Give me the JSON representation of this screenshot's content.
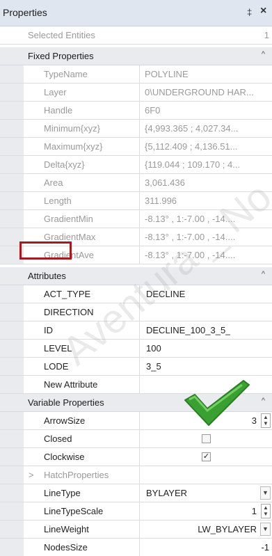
{
  "window": {
    "title": "Properties",
    "pin_glyph": "‡",
    "close_glyph": "×"
  },
  "selected": {
    "label": "Selected Entities",
    "value": "1"
  },
  "fixed": {
    "label": "Fixed Properties",
    "rows": [
      {
        "label": "TypeName",
        "value": "POLYLINE"
      },
      {
        "label": "Layer",
        "value": "0\\UNDERGROUND HAR..."
      },
      {
        "label": "Handle",
        "value": "6F0"
      },
      {
        "label": "Minimum{xyz}",
        "value": "{4,993.365 ; 4,027.34..."
      },
      {
        "label": "Maximum{xyz}",
        "value": "{5,112.409 ; 4,136.51..."
      },
      {
        "label": "Delta{xyz}",
        "value": "{119.044 ; 109.170 ; 4..."
      },
      {
        "label": "Area",
        "value": "3,061.436"
      },
      {
        "label": "Length",
        "value": "311.996"
      },
      {
        "label": "GradientMin",
        "value": "-8.13° , 1:-7.00 , -14...."
      },
      {
        "label": "GradientMax",
        "value": "-8.13° , 1:-7.00 , -14...."
      },
      {
        "label": "GradientAve",
        "value": "-8.13° , 1:-7.00 , -14...."
      }
    ]
  },
  "attributes": {
    "label": "Attributes",
    "rows": [
      {
        "label": "ACT_TYPE",
        "value": "DECLINE"
      },
      {
        "label": "DIRECTION",
        "value": ""
      },
      {
        "label": "ID",
        "value": "DECLINE_100_3_5_"
      },
      {
        "label": "LEVEL",
        "value": "100"
      },
      {
        "label": "LODE",
        "value": "3_5"
      },
      {
        "label": "New Attribute",
        "value": ""
      }
    ]
  },
  "variable": {
    "label": "Variable Properties",
    "arrowsize": {
      "label": "ArrowSize",
      "value": "3"
    },
    "closed": {
      "label": "Closed",
      "checked": false
    },
    "clockwise": {
      "label": "Clockwise",
      "checked": true,
      "check_glyph": "✓"
    },
    "hatch": {
      "label": "HatchProperties",
      "expander": ">"
    },
    "linetype": {
      "label": "LineType",
      "value": "BYLAYER"
    },
    "linetypescale": {
      "label": "LineTypeScale",
      "value": "1"
    },
    "lineweight": {
      "label": "LineWeight",
      "value": "LW_BYLAYER"
    },
    "nodessize": {
      "label": "NodesSize",
      "value": "-1"
    }
  },
  "icons": {
    "chevron_up": "^",
    "spin": "▲▼",
    "dropdown": "▼"
  },
  "watermark": "Aventura _ No",
  "colors": {
    "annotation_box": "#a01c23",
    "checkmark": "#3aa031",
    "category_bg": "#e9ebef"
  }
}
